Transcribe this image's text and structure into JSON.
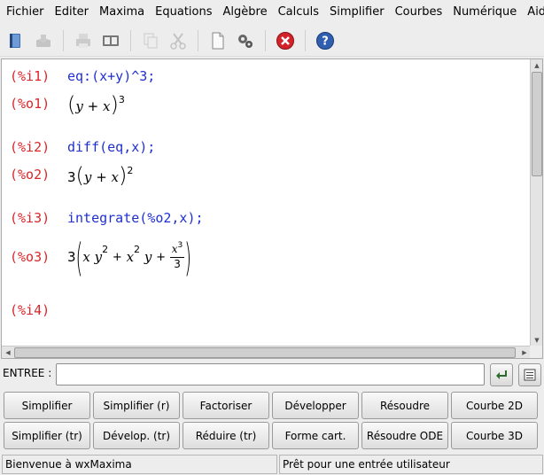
{
  "menubar": {
    "items": [
      "Fichier",
      "Editer",
      "Maxima",
      "Equations",
      "Algèbre",
      "Calculs",
      "Simplifier",
      "Courbes",
      "Numérique",
      "Aide"
    ]
  },
  "toolbar": {
    "icons": [
      "open-book-icon",
      "save-icon",
      "print-icon",
      "print-preview-icon",
      "copy-icon",
      "cut-icon",
      "new-document-icon",
      "configure-icon",
      "interrupt-icon",
      "help-icon"
    ]
  },
  "worksheet": {
    "cells": [
      {
        "in_label": "(%i1)",
        "input": "eq:(x+y)^3;",
        "out_label": "(%o1)"
      },
      {
        "in_label": "(%i2)",
        "input": "diff(eq,x);",
        "out_label": "(%o2)"
      },
      {
        "in_label": "(%i3)",
        "input": "integrate(%o2,x);",
        "out_label": "(%o3)"
      },
      {
        "in_label": "(%i4)",
        "input": ""
      }
    ],
    "math": {
      "o1": {
        "lparen": "(",
        "y": "y",
        "plus": "+",
        "x": "x",
        "rparen": ")",
        "exp": "3"
      },
      "o2": {
        "coef": "3",
        "lparen": "(",
        "y": "y",
        "plus": "+",
        "x": "x",
        "rparen": ")",
        "exp": "2"
      },
      "o3": {
        "coef": "3",
        "lparen": "(",
        "t1x": "x",
        "t1y": "y",
        "t1exp": "2",
        "plus1": "+",
        "t2x": "x",
        "t2exp": "2",
        "t2y": "y",
        "plus2": "+",
        "num": "x",
        "numexp": "3",
        "den": "3",
        "rparen": ")"
      }
    }
  },
  "entry": {
    "label": "ENTREE :",
    "value": ""
  },
  "buttons": {
    "row1": [
      "Simplifier",
      "Simplifier (r)",
      "Factoriser",
      "Développer",
      "Résoudre",
      "Courbe 2D"
    ],
    "row2": [
      "Simplifier (tr)",
      "Dévelop. (tr)",
      "Réduire (tr)",
      "Forme cart.",
      "Résoudre ODE",
      "Courbe 3D"
    ]
  },
  "status": {
    "left": "Bienvenue à wxMaxima",
    "right": "Prêt pour une entrée utilisateur"
  }
}
